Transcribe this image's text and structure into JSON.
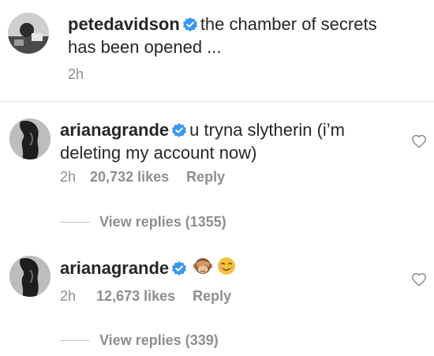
{
  "post": {
    "username": "petedavidson",
    "caption": "the chamber of secrets has been opened ...",
    "caption_line1": "the chamber of secrets",
    "caption_line2": "has been opened ...",
    "time": "2h"
  },
  "comments": [
    {
      "username": "arianagrande",
      "text_line1": "u tryna slytherin (i’m",
      "text_line2": "deleting my account now)",
      "time": "2h",
      "likes": "20,732 likes",
      "reply_label": "Reply",
      "view_replies": "View replies (1355)"
    },
    {
      "username": "arianagrande",
      "emojis": [
        "see-no-evil-monkey",
        "smiling-face"
      ],
      "time": "2h",
      "likes": "12,673 likes",
      "reply_label": "Reply",
      "view_replies": "View replies (339)"
    }
  ],
  "colors": {
    "text": "#262626",
    "muted": "#8e8e8e",
    "verified": "#3897f0",
    "divider": "#e6e6e6"
  }
}
